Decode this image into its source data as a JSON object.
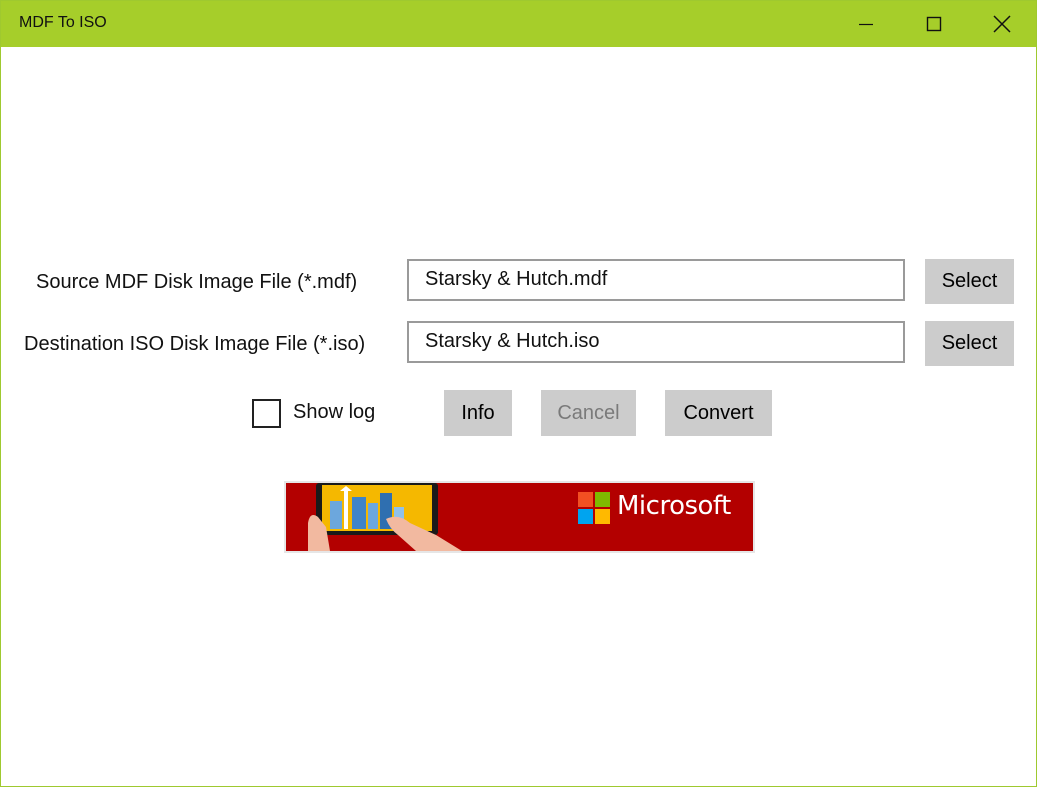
{
  "window": {
    "title": "MDF To ISO"
  },
  "form": {
    "source": {
      "label": "Source MDF Disk Image File (*.mdf)",
      "value": "Starsky & Hutch.mdf",
      "button": "Select"
    },
    "destination": {
      "label": "Destination ISO Disk Image File (*.iso)",
      "value": "Starsky & Hutch.iso",
      "button": "Select"
    }
  },
  "actions": {
    "show_log_label": "Show log",
    "show_log_checked": false,
    "info": "Info",
    "cancel": "Cancel",
    "convert": "Convert"
  },
  "ad": {
    "brand": "Microsoft",
    "colors": {
      "background": "#b30000",
      "logo_red": "#f25022",
      "logo_green": "#7fba00",
      "logo_blue": "#00a4ef",
      "logo_yellow": "#ffb900"
    }
  },
  "colors": {
    "titlebar": "#a6ce2a",
    "button": "#cccccc"
  }
}
